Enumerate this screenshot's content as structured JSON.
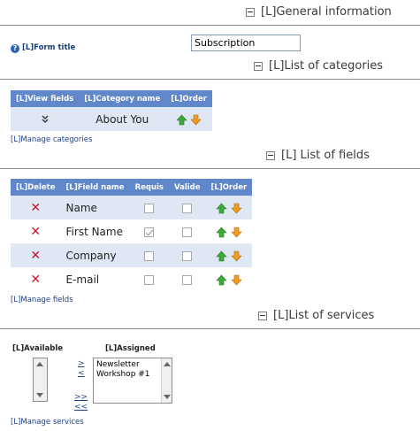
{
  "general": {
    "title": "[L]General information"
  },
  "form_title": {
    "label": "[L]Form title",
    "value": "Subscription"
  },
  "categories": {
    "title": "[L]List of categories",
    "columns": [
      "[L]View fields",
      "[L]Category name",
      "[L]Order"
    ],
    "rows": [
      {
        "name": "About You"
      }
    ],
    "manage_link": "[L]Manage categories"
  },
  "fields": {
    "title": "[L] List of fields",
    "columns": [
      "[L]Delete",
      "[L]Field name",
      "Requis",
      "Valide",
      "[L]Order"
    ],
    "rows": [
      {
        "name": "Name",
        "required": false,
        "validate": false
      },
      {
        "name": "First Name",
        "required": true,
        "validate": false
      },
      {
        "name": "Company",
        "required": false,
        "validate": false
      },
      {
        "name": "E-mail",
        "required": false,
        "validate": false
      }
    ],
    "manage_link": "[L]Manage fields"
  },
  "services": {
    "title": "[L]List of services",
    "available_label": "[L]Available",
    "assigned_label": "[L]Assigned",
    "assigned_items": [
      "Newsletter",
      "Workshop #1"
    ],
    "move_right": ">",
    "move_left": "<",
    "move_all_right": ">>",
    "move_all_left": "<<",
    "manage_link": "[L]Manage services"
  },
  "colors": {
    "header_bg": "#5f87c9",
    "row_alt": "#dfe7f5",
    "link": "#1e3f8a",
    "delete": "#d0102b"
  }
}
